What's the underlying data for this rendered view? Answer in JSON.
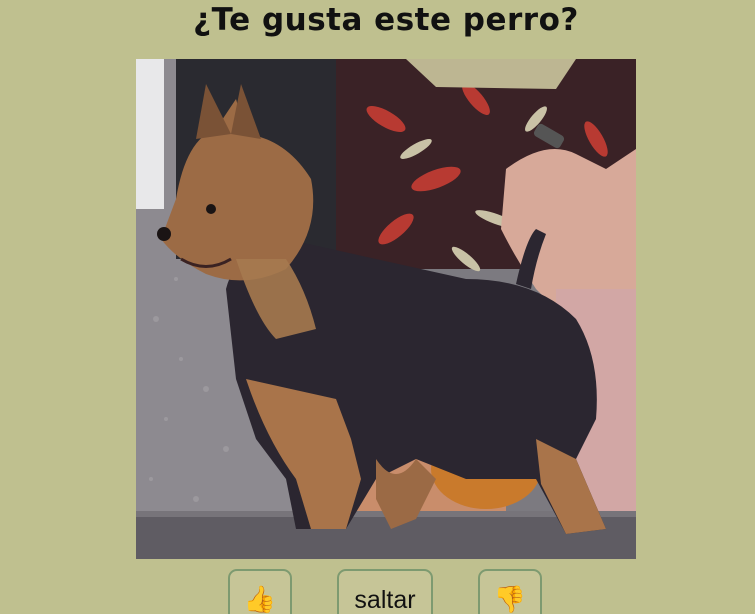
{
  "page": {
    "title": "¿Te gusta este perro?"
  },
  "photo": {
    "subject": "dog-photo"
  },
  "buttons": {
    "like_icon": "👍",
    "skip_label": "saltar",
    "dislike_icon": "👎"
  },
  "colors": {
    "background": "#bfc08f",
    "button_border": "#7d9a70",
    "thumb_color": "#f1b322"
  }
}
